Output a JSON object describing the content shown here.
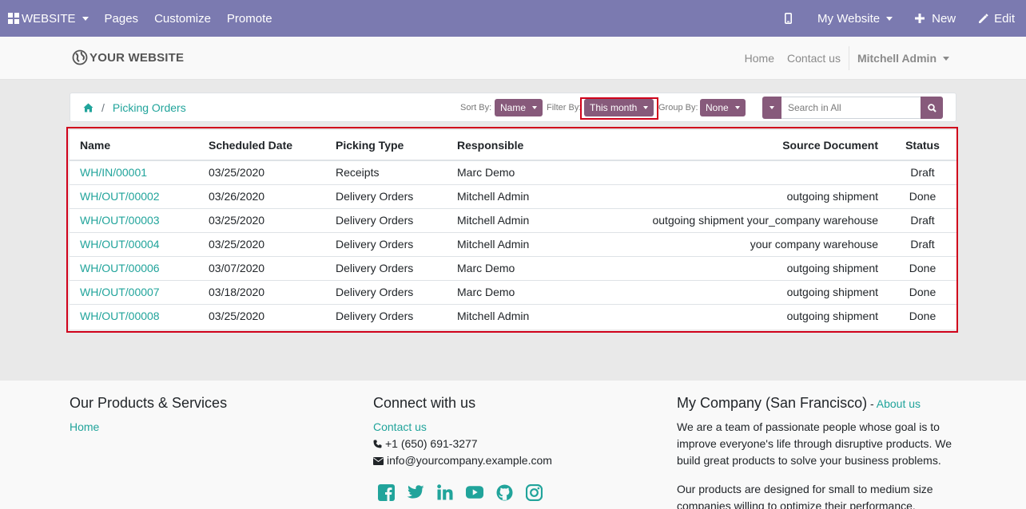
{
  "admin_bar": {
    "website_menu": "WEBSITE",
    "pages": "Pages",
    "customize": "Customize",
    "promote": "Promote",
    "my_website": "My Website",
    "new": "New",
    "edit": "Edit",
    "color": "#7b7ab0"
  },
  "site_header": {
    "logo_text": "YOUR WEBSITE",
    "nav": [
      "Home",
      "Contact us"
    ],
    "user": "Mitchell Admin"
  },
  "toolbar": {
    "breadcrumb": "Picking Orders",
    "sort_label": "Sort By:",
    "sort_value": "Name",
    "filter_label": "Filter By:",
    "filter_value": "This month",
    "group_label": "Group By:",
    "group_value": "None",
    "search_placeholder": "Search in All",
    "accent": "#875a7b"
  },
  "table": {
    "columns": [
      "Name",
      "Scheduled Date",
      "Picking Type",
      "Responsible",
      "Source Document",
      "Status"
    ],
    "rows": [
      [
        "WH/IN/00001",
        "03/25/2020",
        "Receipts",
        "Marc Demo",
        "",
        "Draft"
      ],
      [
        "WH/OUT/00002",
        "03/26/2020",
        "Delivery Orders",
        "Mitchell Admin",
        "outgoing shipment",
        "Done"
      ],
      [
        "WH/OUT/00003",
        "03/25/2020",
        "Delivery Orders",
        "Mitchell Admin",
        "outgoing shipment your_company warehouse",
        "Draft"
      ],
      [
        "WH/OUT/00004",
        "03/25/2020",
        "Delivery Orders",
        "Mitchell Admin",
        "your company warehouse",
        "Draft"
      ],
      [
        "WH/OUT/00006",
        "03/07/2020",
        "Delivery Orders",
        "Marc Demo",
        "outgoing shipment",
        "Done"
      ],
      [
        "WH/OUT/00007",
        "03/18/2020",
        "Delivery Orders",
        "Marc Demo",
        "outgoing shipment",
        "Done"
      ],
      [
        "WH/OUT/00008",
        "03/25/2020",
        "Delivery Orders",
        "Mitchell Admin",
        "outgoing shipment",
        "Done"
      ]
    ],
    "link_color": "#21a49b"
  },
  "footer": {
    "col1_title": "Our Products & Services",
    "col1_link": "Home",
    "col2_title": "Connect with us",
    "col2_link": "Contact us",
    "phone": "+1 (650) 691-3277",
    "email": "info@yourcompany.example.com",
    "col3_title": "My Company (San Francisco)",
    "col3_sep": " - ",
    "col3_link": "About us",
    "about_p1": "We are a team of passionate people whose goal is to improve everyone's life through disruptive products. We build great products to solve your business problems.",
    "about_p2": "Our products are designed for small to medium size companies willing to optimize their performance.",
    "social_icons": [
      "facebook-icon",
      "twitter-icon",
      "linkedin-icon",
      "youtube-icon",
      "github-icon",
      "instagram-icon"
    ]
  }
}
